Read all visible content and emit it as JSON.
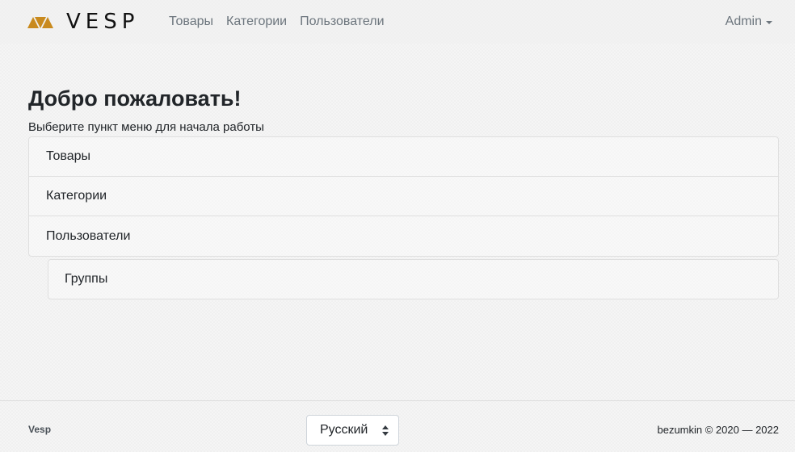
{
  "navbar": {
    "brand_word": "VESP",
    "links": [
      "Товары",
      "Категории",
      "Пользователи"
    ],
    "user": "Admin"
  },
  "main": {
    "title": "Добро пожаловать!",
    "subtitle": "Выберите пункт меню для начала работы",
    "menu_items": [
      "Товары",
      "Категории",
      "Пользователи"
    ],
    "sub_items": [
      "Группы"
    ]
  },
  "footer": {
    "brand": "Vesp",
    "language": "Русский",
    "copyright": "bezumkin © 2020 — 2022"
  },
  "colors": {
    "logo_accent": "#c98a1e",
    "nav_text": "#6c757d",
    "border": "#dfdfdf"
  },
  "icons": [
    "vesp-logo-icon",
    "caret-down-icon",
    "select-arrows-icon"
  ]
}
